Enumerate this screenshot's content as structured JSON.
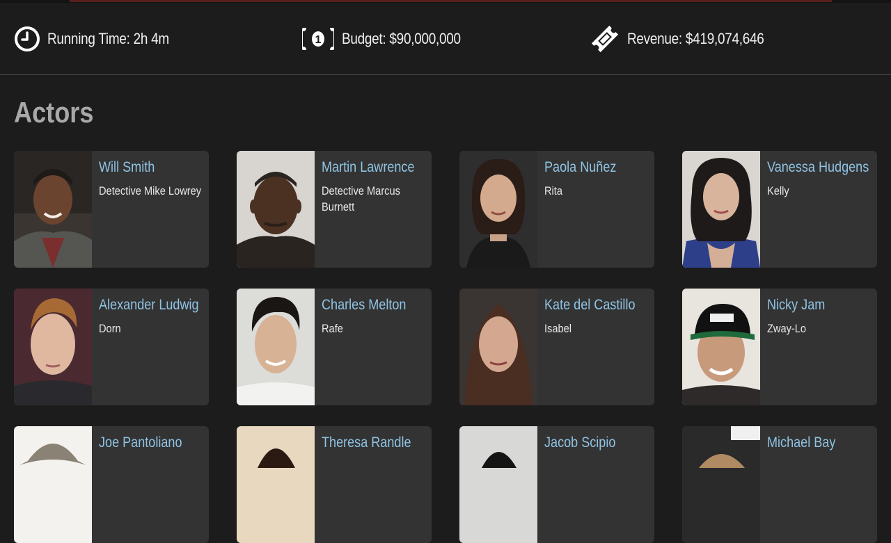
{
  "stats": {
    "running_time": "Running Time: 2h 4m",
    "budget": "Budget: $90,000,000",
    "revenue": "Revenue: $419,074,646"
  },
  "section_title": "Actors",
  "actors": [
    {
      "name": "Will Smith",
      "role": "Detective Mike Lowrey"
    },
    {
      "name": "Martin Lawrence",
      "role": "Detective Marcus Burnett"
    },
    {
      "name": "Paola Nuñez",
      "role": "Rita"
    },
    {
      "name": "Vanessa Hudgens",
      "role": "Kelly"
    },
    {
      "name": "Alexander Ludwig",
      "role": "Dorn"
    },
    {
      "name": "Charles Melton",
      "role": "Rafe"
    },
    {
      "name": "Kate del Castillo",
      "role": "Isabel"
    },
    {
      "name": "Nicky Jam",
      "role": "Zway-Lo"
    },
    {
      "name": "Joe Pantoliano",
      "role": ""
    },
    {
      "name": "Theresa Randle",
      "role": ""
    },
    {
      "name": "Jacob Scipio",
      "role": ""
    },
    {
      "name": "Michael Bay",
      "role": ""
    }
  ],
  "colors": {
    "background": "#1c1c1c",
    "card": "#333333",
    "link": "#8fc3e3",
    "heading": "#a8a8a8"
  }
}
